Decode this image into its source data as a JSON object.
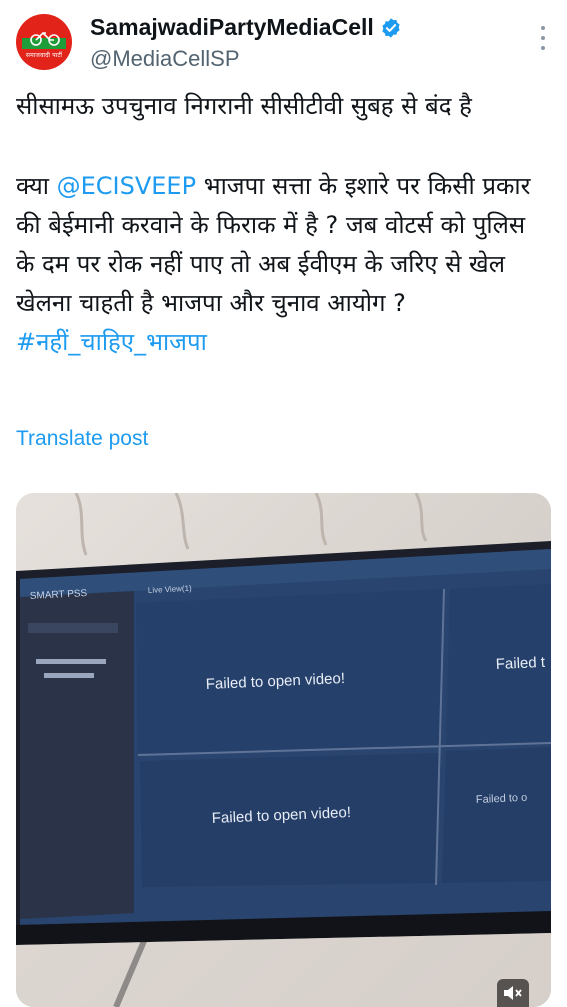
{
  "account": {
    "name": "SamajwadiPartyMediaCell",
    "handle": "@MediaCellSP",
    "avatar_caption": "समाजवादी पार्टी"
  },
  "post": {
    "line1": "सीसामऊ उपचुनाव निगरानी सीसीटीवी सुबह से बंद है",
    "body_prefix": "क्या ",
    "mention": "@ECISVEEP",
    "body_rest": " भाजपा सत्ता के इशारे पर किसी प्रकार की बेईमानी करवाने के फिराक में है ? जब वोटर्स को पुलिस के दम पर रोक नहीं पाए तो अब ईवीएम के जरिए से खेल खेलना चाहती है भाजपा और चुनाव आयोग ?",
    "hashtag": "#नहीं_चाहिए_भाजपा",
    "translate_label": "Translate post"
  },
  "media": {
    "software_title": "SMART PSS",
    "tab_label": "Live View(1)",
    "tiles": [
      "Failed to open video!",
      "Failed t",
      "Failed to open video!",
      "Failed to o"
    ]
  },
  "colors": {
    "link": "#1d9bf0",
    "text": "#0f1419",
    "secondary": "#536471",
    "avatar_red": "#e2231a"
  },
  "icons": [
    "verified-badge-icon",
    "more-options-icon",
    "mute-icon"
  ]
}
